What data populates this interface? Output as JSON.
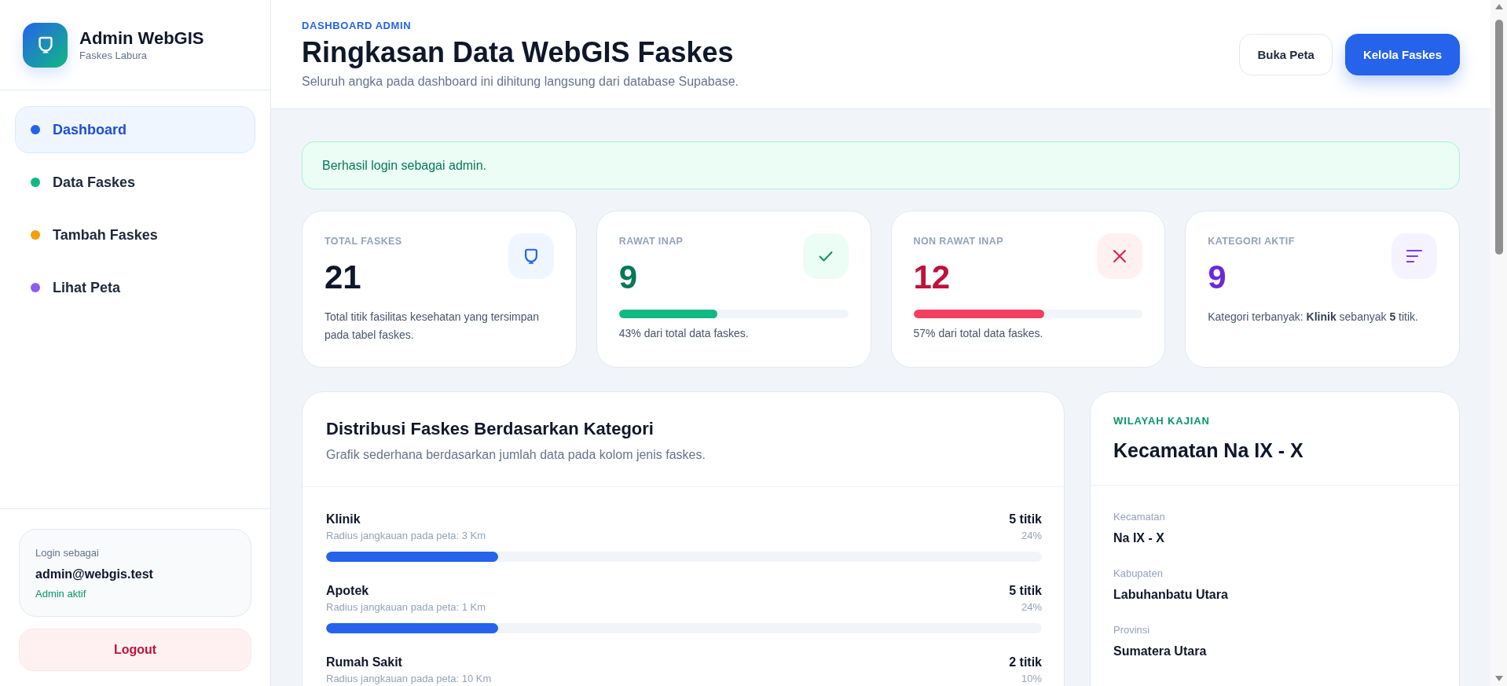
{
  "sidebar": {
    "brand": {
      "title": "Admin WebGIS",
      "subtitle": "Faskes Labura"
    },
    "nav": [
      {
        "label": "Dashboard",
        "color": "#2563eb",
        "selected": true
      },
      {
        "label": "Data Faskes",
        "color": "#10b981",
        "selected": false
      },
      {
        "label": "Tambah Faskes",
        "color": "#f59e0b",
        "selected": false
      },
      {
        "label": "Lihat Peta",
        "color": "#8b5cf6",
        "selected": false
      }
    ],
    "user": {
      "caption": "Login sebagai",
      "email": "admin@webgis.test",
      "status": "Admin aktif"
    },
    "logout": "Logout"
  },
  "header": {
    "eyebrow": "DASHBOARD ADMIN",
    "title": "Ringkasan Data WebGIS Faskes",
    "subtitle": "Seluruh angka pada dashboard ini dihitung langsung dari database Supabase.",
    "buttons": [
      {
        "label": "Buka Peta",
        "kind": "secondary"
      },
      {
        "label": "Kelola Faskes",
        "kind": "primary"
      }
    ]
  },
  "alert": "Berhasil login sebagai admin.",
  "stats": [
    {
      "kind": "total",
      "label": "TOTAL FASKES",
      "value": "21",
      "note": "Total titik fasilitas kesehatan yang tersimpan pada tabel faskes."
    },
    {
      "kind": "inpatient",
      "label": "RAWAT INAP",
      "value": "9",
      "level": 0.43,
      "note": "43% dari total data faskes."
    },
    {
      "kind": "outpatient",
      "label": "NON RAWAT INAP",
      "value": "12",
      "level": 0.57,
      "note": "57% dari total data faskes."
    },
    {
      "kind": "category",
      "label": "KATEGORI AKTIF",
      "value": "9",
      "note": "Kategori terbanyak: **Klinik** sebanyak **5** titik."
    }
  ],
  "distribution": {
    "title": "Distribusi Faskes Berdasarkan Kategori",
    "subtitle": "Grafik sederhana berdasarkan jumlah data pada kolom jenis faskes.",
    "items": [
      {
        "name": "Klinik",
        "radius": "Radius jangkauan pada peta: 3 Km",
        "count": "5 titik",
        "percent": "24%",
        "level": 0.24
      },
      {
        "name": "Apotek",
        "radius": "Radius jangkauan pada peta: 1 Km",
        "count": "5 titik",
        "percent": "24%",
        "level": 0.24
      },
      {
        "name": "Rumah Sakit",
        "radius": "Radius jangkauan pada peta: 10 Km",
        "count": "2 titik",
        "percent": "10%"
      }
    ]
  },
  "region": {
    "eyebrow": "WILAYAH KAJIAN",
    "title": "Kecamatan Na IX - X",
    "fields": [
      {
        "label": "Kecamatan",
        "value": "Na IX - X"
      },
      {
        "label": "Kabupaten",
        "value": "Labuhanbatu Utara"
      },
      {
        "label": "Provinsi",
        "value": "Sumatera Utara"
      }
    ]
  }
}
